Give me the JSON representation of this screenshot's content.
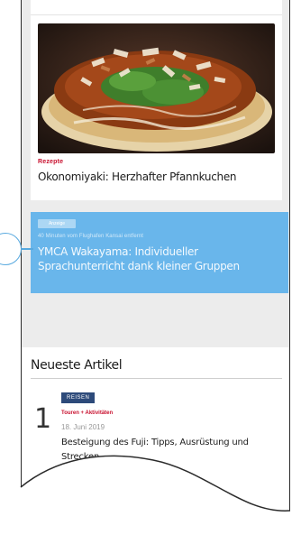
{
  "card_food": {
    "category": "Rezepte",
    "title": "Okonomiyaki: Herzhafter Pfannkuchen"
  },
  "card_highlight": {
    "tag": "Anzeige",
    "subtitle": "40 Minuten vom Flughafen Kansai entfernt",
    "title": "YMCA Wakayama: Individueller Sprachunterricht dank kleiner Gruppen",
    "highlight_color": "#5cb0e9"
  },
  "newest": {
    "heading": "Neueste Artikel",
    "items": [
      {
        "number": "1",
        "badge": "REISEN",
        "category": "Touren + Aktivitäten",
        "date": "18. Juni 2019",
        "title": "Besteigung des Fuji: Tipps, Ausrüstung und Strecken"
      }
    ]
  },
  "colors": {
    "accent_red": "#c8102e",
    "badge_blue": "#2d4a7a"
  }
}
